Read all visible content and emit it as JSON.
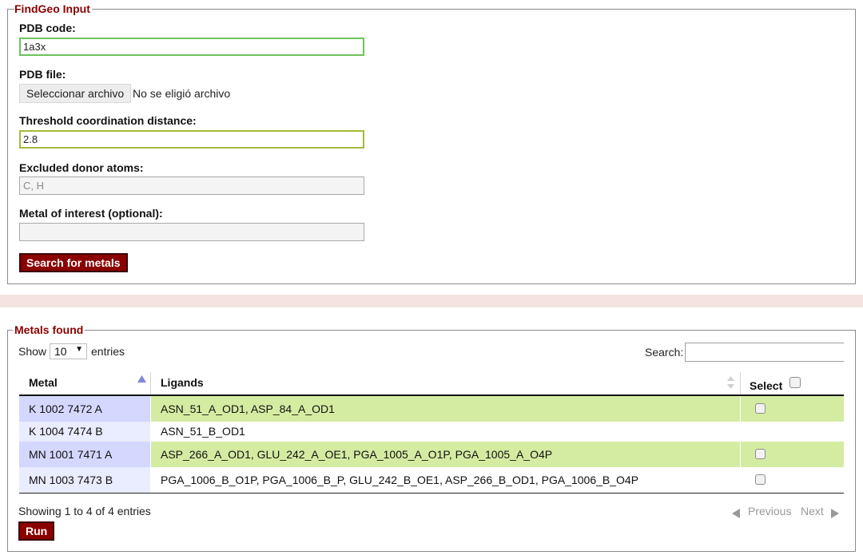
{
  "input_form": {
    "legend": "FindGeo Input",
    "pdb_code_label": "PDB code:",
    "pdb_code_value": "1a3x",
    "pdb_file_label": "PDB file:",
    "file_button_label": "Seleccionar archivo",
    "file_status": "No se eligió archivo",
    "threshold_label": "Threshold coordination distance:",
    "threshold_value": "2.8",
    "excluded_label": "Excluded donor atoms:",
    "excluded_placeholder": "C, H",
    "metal_label": "Metal of interest (optional):",
    "metal_value": "",
    "search_button": "Search for metals"
  },
  "results": {
    "legend": "Metals found",
    "show_label": "Show",
    "entries_per_page": "10",
    "entries_label": "entries",
    "search_label": "Search:",
    "columns": {
      "metal": "Metal",
      "ligands": "Ligands",
      "select": "Select"
    },
    "rows": [
      {
        "metal": "K 1002 7472 A",
        "ligands": "ASN_51_A_OD1, ASP_84_A_OD1",
        "highlighted": true
      },
      {
        "metal": "K 1004 7474 B",
        "ligands": "ASN_51_B_OD1",
        "highlighted": false
      },
      {
        "metal": "MN 1001 7471 A",
        "ligands": "ASP_266_A_OD1, GLU_242_A_OE1, PGA_1005_A_O1P, PGA_1005_A_O4P",
        "highlighted": true
      },
      {
        "metal": "MN 1003 7473 B",
        "ligands": "PGA_1006_B_O1P, PGA_1006_B_P, GLU_242_B_OE1, ASP_266_B_OD1, PGA_1006_B_O4P",
        "highlighted": false
      }
    ],
    "info": "Showing 1 to 4 of 4 entries",
    "previous_label": "Previous",
    "next_label": "Next",
    "run_button": "Run"
  },
  "colors": {
    "legend_text": "#8b0000",
    "button_bg": "#8b0000",
    "row_highlight": "#d4eca2",
    "metal_col_highlight": "#d4d8ff",
    "metal_col_plain": "#eaecff",
    "divider": "#f4e3de"
  }
}
